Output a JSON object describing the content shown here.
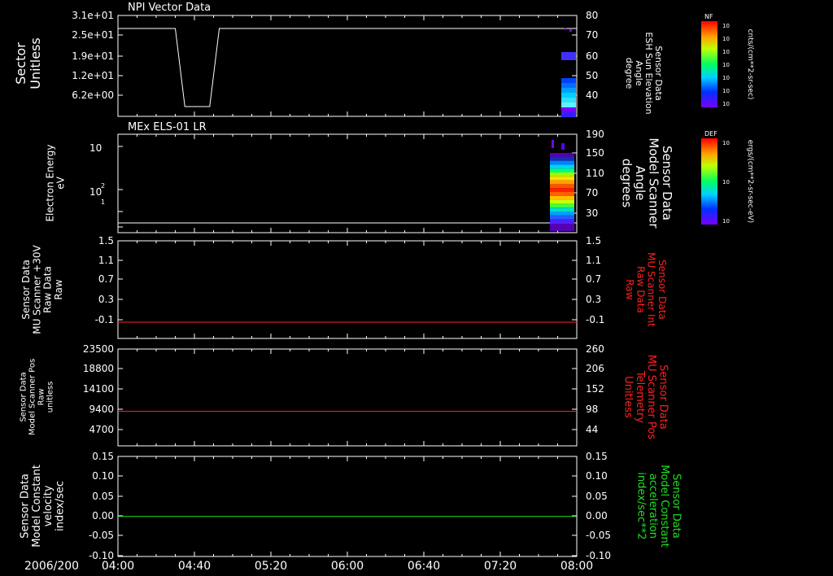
{
  "date_label": "2006/200",
  "time_ticks": [
    "04:00",
    "04:40",
    "05:20",
    "06:00",
    "06:40",
    "07:20",
    "08:00"
  ],
  "colors": {
    "frame": "#ffffff",
    "panel3_right": "#ff2020",
    "panel5_right": "#20e020",
    "red_trace": "#ff2020",
    "green_trace": "#20e020"
  },
  "panels": [
    {
      "title": "NPI Vector Data",
      "left_label": [
        "Sector",
        "Unitless"
      ],
      "left_ticks": [
        "3.1e+01",
        "2.5e+01",
        "1.9e+01",
        "1.2e+01",
        "6.2e+00"
      ],
      "right_label": [
        "Sensor Data",
        "ESH Sun Elevation",
        "Angle",
        "degree"
      ],
      "right_ticks": [
        "80",
        "70",
        "60",
        "50",
        "40"
      ]
    },
    {
      "title": "MEx ELS-01 LR",
      "left_label": [
        "Electron Energy",
        "eV"
      ],
      "left_ticks": [
        "10",
        "2",
        "10",
        "1"
      ],
      "right_label": [
        "Sensor Data",
        "Model Scanner",
        "Angle",
        "degrees"
      ],
      "right_ticks": [
        "190",
        "150",
        "110",
        "70",
        "30"
      ]
    },
    {
      "title": "",
      "left_label": [
        "Sensor Data",
        "MU Scanner +30V",
        "Raw Data",
        "Raw"
      ],
      "left_ticks": [
        "1.5",
        "1.1",
        "0.7",
        "0.3",
        "-0.1"
      ],
      "right_label": [
        "Sensor Data",
        "MU Scanner Int",
        "Raw Data",
        "Raw"
      ],
      "right_ticks": [
        "1.5",
        "1.1",
        "0.7",
        "0.3",
        "-0.1"
      ]
    },
    {
      "title": "",
      "left_label": [
        "Sensor Data",
        "Model Scanner Pos",
        "Raw",
        "unitless"
      ],
      "left_ticks": [
        "23500",
        "18800",
        "14100",
        "9400",
        "4700"
      ],
      "right_label": [
        "Sensor Data",
        "MU Scanner Pos",
        "Telemetry",
        "Unitless"
      ],
      "right_ticks": [
        "260",
        "206",
        "152",
        "98",
        "44"
      ]
    },
    {
      "title": "",
      "left_label": [
        "Sensor Data",
        "Model Constant",
        "velocity",
        "index/sec"
      ],
      "left_ticks": [
        "0.15",
        "0.10",
        "0.05",
        "0.00",
        "-0.05",
        "-0.10"
      ],
      "right_label": [
        "Sensor Data",
        "Model Constant",
        "acceleration",
        "index/sec**2"
      ],
      "right_ticks": [
        "0.15",
        "0.10",
        "0.05",
        "0.00",
        "-0.05",
        "-0.10"
      ]
    }
  ],
  "colorbars": [
    {
      "label": "NF",
      "units": "cnts/(cm**2-sr-sec)",
      "ticks": [
        "10",
        "10",
        "10",
        "10",
        "10",
        "10",
        "10"
      ]
    },
    {
      "label": "DEF",
      "units": "ergs/(cm**2-sr-sec-eV)",
      "ticks": [
        "10",
        "10",
        "10"
      ]
    }
  ],
  "chart_data": [
    {
      "type": "line",
      "title": "NPI Vector Data",
      "xlabel": "",
      "ylabel": "Sector Unitless",
      "x": [
        "04:00",
        "04:30",
        "04:35",
        "04:48",
        "04:53",
        "08:00"
      ],
      "y": [
        27,
        27,
        3,
        3,
        27,
        27
      ],
      "ylim": [
        0,
        31
      ],
      "xlim": [
        "04:00",
        "08:00"
      ]
    },
    {
      "type": "heatmap",
      "title": "MEx ELS-01 LR",
      "ylabel": "Electron Energy eV",
      "scale": "log",
      "x_range": [
        "07:45",
        "08:00"
      ],
      "ylim": [
        1,
        200
      ]
    },
    {
      "type": "line",
      "ylabel": "Sensor Data MU Scanner +30V Raw Data Raw",
      "x": [
        "04:00",
        "08:00"
      ],
      "y": [
        0.0,
        0.0
      ],
      "ylim": [
        -0.3,
        1.5
      ],
      "color": "#ff2020"
    },
    {
      "type": "line",
      "ylabel": "Sensor Data Model Scanner Pos Raw unitless",
      "x": [
        "04:00",
        "08:00"
      ],
      "y": [
        8400,
        8400
      ],
      "ylim": [
        0,
        23500
      ],
      "color": "#ff2020"
    },
    {
      "type": "line",
      "ylabel": "Sensor Data Model Constant velocity index/sec",
      "x": [
        "04:00",
        "08:00"
      ],
      "y": [
        0.0,
        0.0
      ],
      "ylim": [
        -0.1,
        0.15
      ],
      "color": "#20e020"
    }
  ]
}
